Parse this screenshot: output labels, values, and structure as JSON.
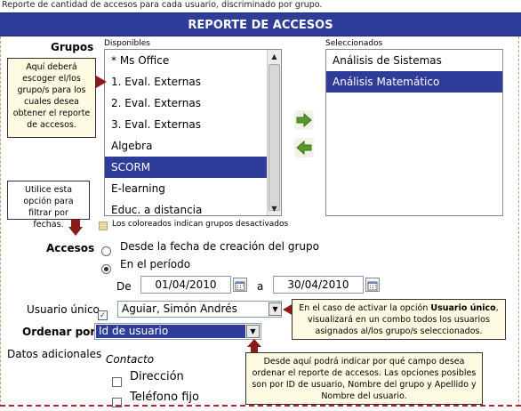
{
  "top_note": "Reporte de cantidad de accesos para cada usuario, discriminado por grupo.",
  "header_title": "REPORTE DE ACCESOS",
  "grupos": {
    "label": "Grupos",
    "available_label": "Disponibles",
    "selected_label": "Seleccionados",
    "available": [
      "* Ms Office",
      "1. Eval. Externas",
      "2. Eval. Externas",
      "3. Eval. Externas",
      "Algebra",
      "SCORM",
      "E-learning",
      "Educ. a distancia"
    ],
    "available_selected_index": 5,
    "selected": [
      "Análisis de Sistemas",
      "Análisis Matemático"
    ],
    "selected_selected_index": 1,
    "legend": "Los coloreados indican grupos desactivados"
  },
  "notes": {
    "grupos_help": "Aquí deberá escoger el/los grupo/s para los cuales desea obtener el reporte de accesos.",
    "fechas_help": "Utilice esta opción para filtrar por fechas.",
    "usuario_help_pre": "En el caso de activar la opción ",
    "usuario_help_bold": "Usuario único",
    "usuario_help_post": ", visualizará en un combo todos los usuarios asignados al/los grupo/s seleccionados.",
    "ordenar_help": "Desde aquí podrá indicar por qué campo desea ordenar el reporte de accesos. Las opciones posibles son por ID de usuario, Nombre del grupo y Apellido y Nombre del usuario."
  },
  "accesos": {
    "label": "Accesos",
    "option_creation": "Desde la fecha de creación del grupo",
    "option_period": "En el período",
    "selected": "period",
    "de_label": "De",
    "a_label": "a",
    "date_from": "01/04/2010",
    "date_to": "30/04/2010"
  },
  "usuario_unico": {
    "label": "Usuario único",
    "checked": true,
    "value": "Aguiar, Simón Andrés"
  },
  "ordenar": {
    "label": "Ordenar por",
    "value": "Id de usuario"
  },
  "datos_adicionales": {
    "label": "Datos adicionales",
    "section": "Contacto",
    "options": [
      "Dirección",
      "Teléfono fijo"
    ]
  },
  "colors": {
    "header": "#2f3c9a",
    "selection": "#2f3c9a",
    "note_bg": "#fffbe3",
    "arrow_red": "#8b1a1a",
    "arrow_green": "#5a9a2a"
  }
}
